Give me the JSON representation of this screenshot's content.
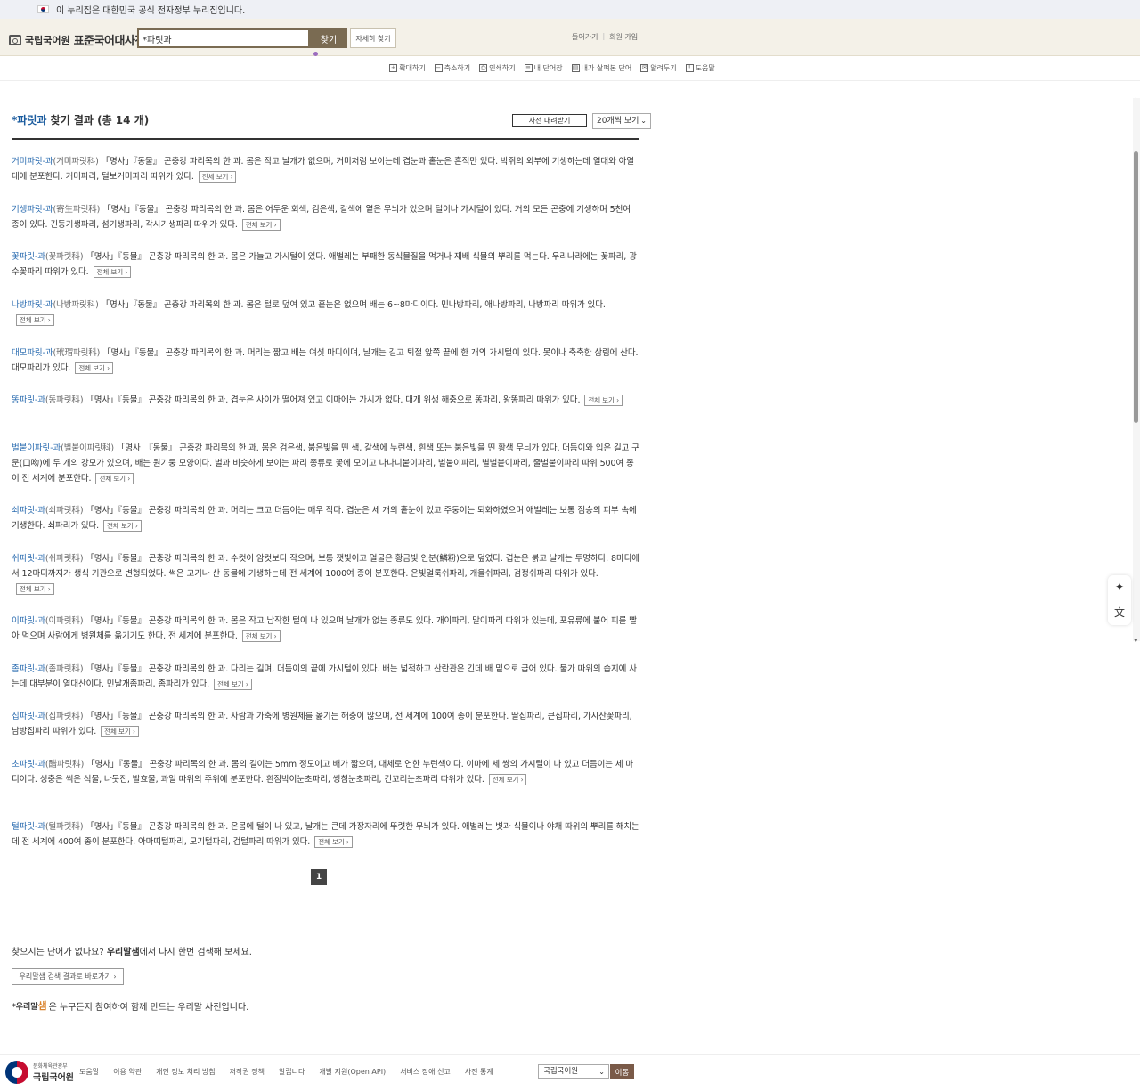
{
  "gov_banner": {
    "text": "이 누리집은 대한민국 공식 전자정부 누리집입니다."
  },
  "header": {
    "institute": "국립국어원",
    "title": "표준국어대사전",
    "search_value": "*파릿과",
    "search_button": "찾기",
    "detail_button": "자세히 찾기",
    "login": "들어가기",
    "signup": "회원 가입"
  },
  "toolbar": [
    {
      "icon": "+",
      "label": "확대하기"
    },
    {
      "icon": "−",
      "label": "축소하기"
    },
    {
      "icon": "⎙",
      "label": "인쇄하기"
    },
    {
      "icon": "≡",
      "label": "내 단어장"
    },
    {
      "icon": "▤",
      "label": "내가 살펴본 단어"
    },
    {
      "icon": "✉",
      "label": "알려두기"
    },
    {
      "icon": "!",
      "label": "도움말"
    }
  ],
  "results_header": {
    "keyword": "*파릿과",
    "suffix": "찾기 결과 (총 14 개)",
    "download": "사전 내려받기",
    "per_page": "20개씩 보기"
  },
  "full_view_label": "전체 보기",
  "entries": [
    {
      "word": "거미파릿-과",
      "orig": "(거미파릿科)",
      "def": "「명사」『동물』 곤충강 파리목의 한 과. 몸은 작고 날개가 없으며, 거미처럼 보이는데 겹눈과 홑눈은 흔적만 있다. 박쥐의 외부에 기생하는데 열대와 아열대에 분포한다. 거미파리, 털보거미파리 따위가 있다."
    },
    {
      "word": "기생파릿-과",
      "orig": "(寄生파릿科)",
      "def": "「명사」『동물』 곤충강 파리목의 한 과. 몸은 어두운 회색, 검은색, 갈색에 옅은 무늬가 있으며 털이나 가시털이 있다. 거의 모든 곤충에 기생하며 5천여 종이 있다. 긴등기생파리, 섬기생파리, 각시기생파리 따위가 있다."
    },
    {
      "word": "꽃파릿-과",
      "orig": "(꽃파릿科)",
      "def": "「명사」『동물』 곤충강 파리목의 한 과. 몸은 가늘고 가시털이 있다. 애벌레는 부패한 동식물질을 먹거나 재배 식물의 뿌리를 먹는다. 우리나라에는 꽃파리, 광수꽃파리 따위가 있다."
    },
    {
      "word": "나방파릿-과",
      "orig": "(나방파릿科)",
      "def": "「명사」『동물』 곤충강 파리목의 한 과. 몸은 털로 덮여 있고 홑눈은 없으며 배는 6~8마디이다. 민나방파리, 애나방파리, 나방파리 따위가 있다."
    },
    {
      "word": "대모파릿-과",
      "orig": "(玳瑁파릿科)",
      "def": "「명사」『동물』 곤충강 파리목의 한 과. 머리는 짧고 배는 여섯 마디이며, 날개는 길고 퇴절 앞쪽 끝에 한 개의 가시털이 있다. 못이나 축축한 삼림에 산다. 대모파리가 있다."
    },
    {
      "word": "똥파릿-과",
      "orig": "(똥파릿科)",
      "def": "「명사」『동물』 곤충강 파리목의 한 과. 겹눈은 사이가 떨어져 있고 이마에는 가시가 없다. 대개 위생 해충으로 똥파리, 왕똥파리 따위가 있다."
    },
    {
      "word": "벌붙이파릿-과",
      "orig": "(벌붙이파릿科)",
      "def": "「명사」『동물』 곤충강 파리목의 한 과. 몸은 검은색, 붉은빛을 띤 색, 갈색에 누런색, 흰색 또는 붉은빛을 띤 황색 무늬가 있다. 더듬이와 입은 길고 구문(口吻)에 두 개의 강모가 있으며, 배는 원기둥 모양이다. 벌과 비슷하게 보이는 파리 종류로 꽃에 모이고 나나니붙이파리, 벌붙이파리, 별벌붙이파리, 줄벌붙이파리 따위 500여 종이 전 세계에 분포한다."
    },
    {
      "word": "쇠파릿-과",
      "orig": "(쇠파릿科)",
      "def": "「명사」『동물』 곤충강 파리목의 한 과. 머리는 크고 더듬이는 매우 작다. 겹눈은 세 개의 홑눈이 있고 주둥이는 퇴화하였으며 애벌레는 보통 점승의 피부 속에 기생한다. 쇠파리가 있다."
    },
    {
      "word": "쉬파릿-과",
      "orig": "(쉬파릿科)",
      "def": "「명사」『동물』 곤충강 파리목의 한 과. 수컷이 암컷보다 작으며, 보통 잿빛이고 얼굴은 황금빛 인분(鱗粉)으로 덮였다. 겹눈은 붉고 날개는 투명하다. 8마디에서 12마디까지가 생식 기관으로 변형되었다. 썩은 고기나 산 동물에 기생하는데 전 세계에 1000여 종이 분포한다. 은빛얼룩쉬파리, 개울쉬파리, 검정쉬파리 따위가 있다."
    },
    {
      "word": "이파릿-과",
      "orig": "(이파릿科)",
      "def": "「명사」『동물』 곤충강 파리목의 한 과. 몸은 작고 납작한 털이 나 있으며 날개가 없는 종류도 있다. 개이파리, 말이파리 따위가 있는데, 포유류에 붙어 피를 빨아 먹으며 사람에게 병원체를 옮기기도 한다. 전 세계에 분포한다."
    },
    {
      "word": "좀파릿-과",
      "orig": "(좀파릿科)",
      "def": "「명사」『동물』 곤충강 파리목의 한 과. 다리는 길며, 더듬이의 끝에 가시털이 있다. 배는 넓적하고 산란관은 긴데 배 밑으로 굽어 있다. 물가 따위의 습지에 사는데 대부분이 열대산이다. 민날개좀파리, 좀파리가 있다."
    },
    {
      "word": "집파릿-과",
      "orig": "(집파릿科)",
      "def": "「명사」『동물』 곤충강 파리목의 한 과. 사람과 가축에 병원체를 옮기는 해충이 많으며, 전 세계에 100여 종이 분포한다. 딸집파리, 큰집파리, 가시산꽃파리, 남방집파리 따위가 있다."
    },
    {
      "word": "초파릿-과",
      "orig": "(醋파릿科)",
      "def": "「명사」『동물』 곤충강 파리목의 한 과. 몸의 길이는 5mm 정도이고 배가 짧으며, 대체로 연한 누런색이다. 이마에 세 쌍의 가시털이 나 있고 더듬이는 세 마디이다. 성충은 썩은 식물, 나뭇진, 발효물, 과일 따위의 주위에 분포한다. 흰점박이눈초파리, 씽침눈초파리, 긴꼬리눈초파리 따위가 있다."
    },
    {
      "word": "털파릿-과",
      "orig": "(털파릿科)",
      "def": "「명사」『동물』 곤충강 파리목의 한 과. 온몸에 털이 나 있고, 날개는 큰데 가장자리에 뚜렷한 무늬가 있다. 애벌레는 볏과 식물이나 야채 따위의 뿌리를 해치는데 전 세계에 400여 종이 분포한다. 아마띠털파리, 모기털파리, 검털파리 따위가 있다."
    }
  ],
  "pagination": {
    "current": "1"
  },
  "urimal": {
    "question_prefix": "찾으시는 단어가 없나요? ",
    "brand": "우리말샘",
    "question_suffix": "에서 다시 한번 검색해 보세요.",
    "button": "우리말샘 검색 결과로 바로가기",
    "note_brand": "*우리말",
    "note_saem": "샘",
    "note_text": "은 누구든지 참여하여 함께 만드는 우리말 사전입니다."
  },
  "footer": {
    "ministry": "문화체육관광부",
    "institute": "국립국어원",
    "links": [
      "도움말",
      "이용 약관",
      "개인 정보 처리 방침",
      "저작권 정책",
      "알립니다",
      "개발 지원(Open API)",
      "서비스 장애 신고",
      "사전 통계"
    ],
    "select_value": "국립국어원",
    "go_button": "이동"
  }
}
